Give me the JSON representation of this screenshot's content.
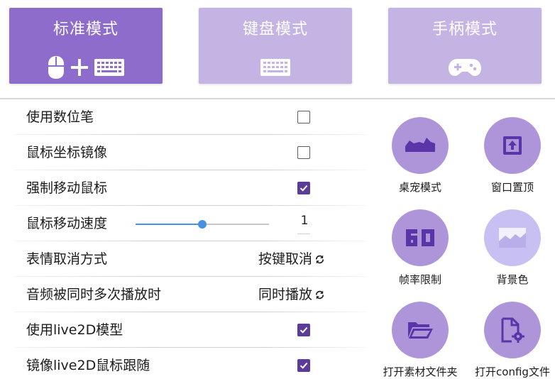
{
  "modes": [
    {
      "id": "standard",
      "label": "标准模式",
      "active": true,
      "icons": [
        "mouse-icon",
        "plus-icon",
        "keyboard-icon"
      ]
    },
    {
      "id": "keyboard",
      "label": "键盘模式",
      "active": false,
      "icons": [
        "keyboard-icon"
      ]
    },
    {
      "id": "gamepad",
      "label": "手柄模式",
      "active": false,
      "icons": [
        "gamepad-icon"
      ]
    }
  ],
  "settings": {
    "use_pen": {
      "label": "使用数位笔",
      "checked": false
    },
    "mirror_mouse": {
      "label": "鼠标坐标镜像",
      "checked": false
    },
    "force_move": {
      "label": "强制移动鼠标",
      "checked": true
    },
    "mouse_speed": {
      "label": "鼠标移动速度",
      "value": "1",
      "fraction": 0.5
    },
    "emotion_cancel": {
      "label": "表情取消方式",
      "value": "按键取消"
    },
    "audio_overlap": {
      "label": "音频被同时多次播放时",
      "value": "同时播放"
    },
    "use_live2d": {
      "label": "使用live2D模型",
      "checked": true
    },
    "mirror_live2d": {
      "label": "镜像live2D鼠标跟随",
      "checked": true
    }
  },
  "actions": [
    {
      "label": "桌宠模式",
      "icon": "desktop-pet-icon"
    },
    {
      "label": "窗口置顶",
      "icon": "pin-top-icon"
    },
    {
      "label": "帧率限制",
      "icon": "fps-60-icon"
    },
    {
      "label": "背景色",
      "icon": "background-color-icon"
    },
    {
      "label": "打开素材文件夹",
      "icon": "folder-open-icon"
    },
    {
      "label": "打开config文件",
      "icon": "config-file-icon"
    }
  ],
  "colors": {
    "accent": "#8e6ccb",
    "accent_light": "#c4b4e4",
    "checkbox": "#5b3d99",
    "slider": "#4a90e2",
    "icon_dark": "#5a35a8"
  }
}
